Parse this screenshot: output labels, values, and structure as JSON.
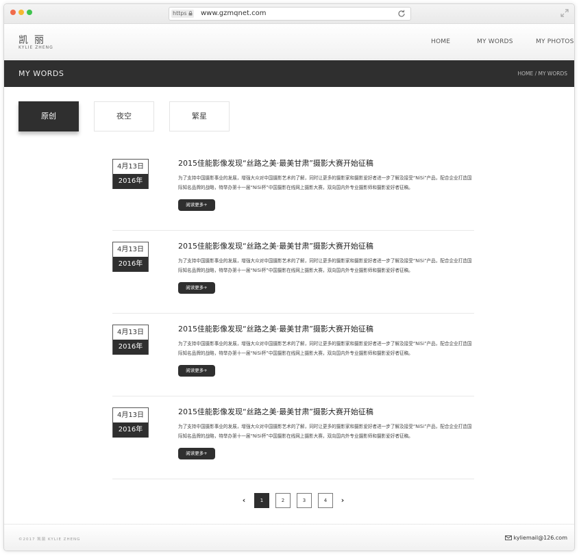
{
  "browser": {
    "https_label": "https",
    "url": "www.gzmqnet.com",
    "dots": [
      "#f06b4b",
      "#f5b731",
      "#3fc34e"
    ]
  },
  "nav": {
    "logo_cn": "凯丽",
    "logo_en": "KYLIE ZHENG",
    "links": [
      "HOME",
      "MY WORDS",
      "MY PHOTOS"
    ]
  },
  "banner": {
    "title": "MY WORDS",
    "breadcrumb": "HOME / MY WORDS"
  },
  "tabs": [
    {
      "label": "原创",
      "active": true
    },
    {
      "label": "夜空",
      "active": false
    },
    {
      "label": "繁星",
      "active": false
    }
  ],
  "articles": [
    {
      "day": "4月13日",
      "year": "2016年",
      "title": "2015佳能影像发现“丝路之美·最美甘肃”摄影大赛开始征稿",
      "body": "为了支持中国摄影事业的发展，增强大众对中国摄影艺术的了解，同时让更多的摄影家和摄影爱好者进一步了解及接受“NiSi”产品，配合企业打造国际知名品牌的战略，特举办第十一届“NiSi杯”中国摄影在线网上摄影大赛，双向国内外专业摄影师和摄影爱好者征稿。",
      "more": "阅读更多+"
    },
    {
      "day": "4月13日",
      "year": "2016年",
      "title": "2015佳能影像发现“丝路之美·最美甘肃”摄影大赛开始征稿",
      "body": "为了支持中国摄影事业的发展，增强大众对中国摄影艺术的了解，同时让更多的摄影家和摄影爱好者进一步了解及接受“NiSi”产品，配合企业打造国际知名品牌的战略，特举办第十一届“NiSi杯”中国摄影在线网上摄影大赛，双向国内外专业摄影师和摄影爱好者征稿。",
      "more": "阅读更多+"
    },
    {
      "day": "4月13日",
      "year": "2016年",
      "title": "2015佳能影像发现“丝路之美·最美甘肃”摄影大赛开始征稿",
      "body": "为了支持中国摄影事业的发展，增强大众对中国摄影艺术的了解，同时让更多的摄影家和摄影爱好者进一步了解及接受“NiSi”产品，配合企业打造国际知名品牌的战略，特举办第十一届“NiSi杯”中国摄影在线网上摄影大赛，双向国内外专业摄影师和摄影爱好者征稿。",
      "more": "阅读更多+"
    },
    {
      "day": "4月13日",
      "year": "2016年",
      "title": "2015佳能影像发现“丝路之美·最美甘肃”摄影大赛开始征稿",
      "body": "为了支持中国摄影事业的发展，增强大众对中国摄影艺术的了解，同时让更多的摄影家和摄影爱好者进一步了解及接受“NiSi”产品，配合企业打造国际知名品牌的战略，特举办第十一届“NiSi杯”中国摄影在线网上摄影大赛，双向国内外专业摄影师和摄影爱好者征稿。",
      "more": "阅读更多+"
    }
  ],
  "pagination": {
    "prev_icon": "chevron-left-icon",
    "pages": [
      "1",
      "2",
      "3",
      "4"
    ],
    "current": "1",
    "next_icon": "chevron-right-icon"
  },
  "footer": {
    "copyright": "©2017 凯丽 KYLIE ZHENG",
    "email": "kyliemail@126.com",
    "email_icon": "envelope-icon"
  },
  "colors": {
    "dark": "#2f2f2f",
    "border": "#e4e4e4"
  }
}
